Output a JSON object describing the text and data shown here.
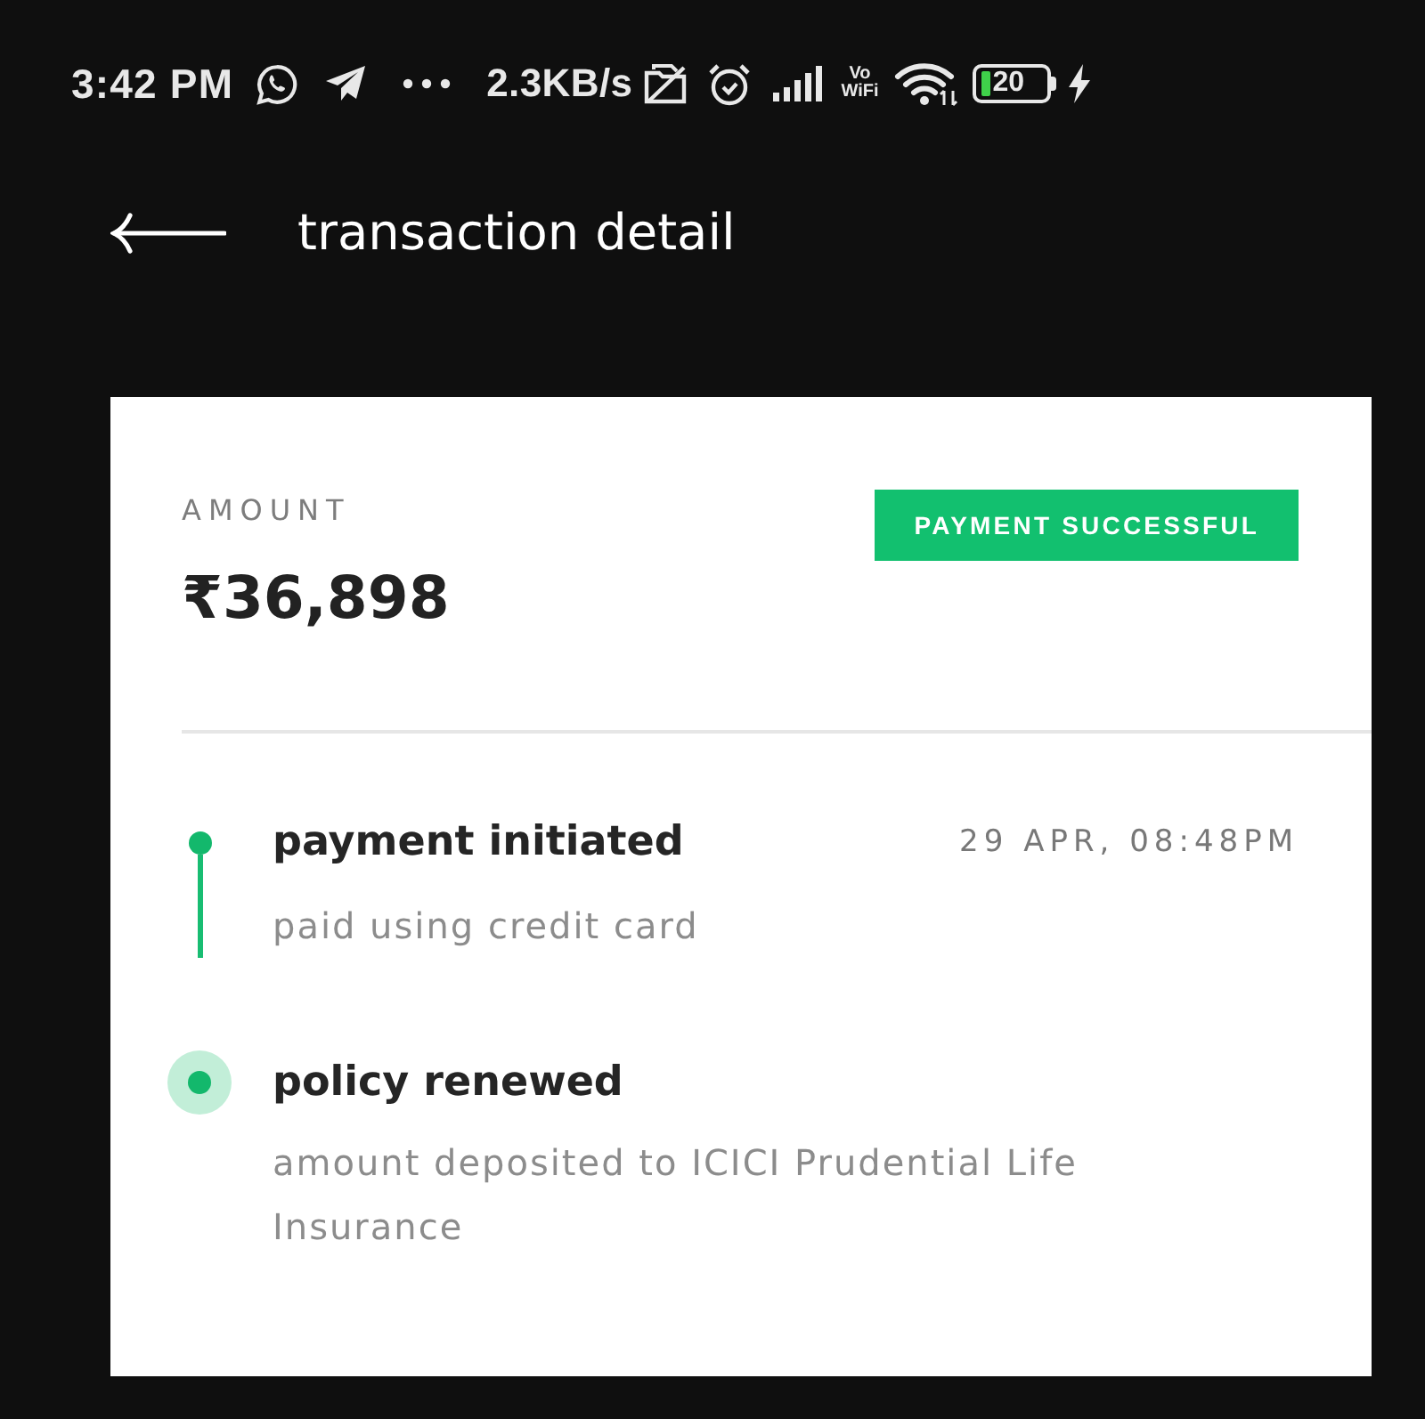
{
  "status_bar": {
    "time": "3:42 PM",
    "net_speed": "2.3KB/s",
    "vowifi_label": "Vo\nWiFi",
    "battery_text": "20"
  },
  "header": {
    "title": "transaction detail"
  },
  "summary": {
    "label": "AMOUNT",
    "amount": "₹36,898",
    "status_badge": "PAYMENT SUCCESSFUL"
  },
  "timeline": [
    {
      "title": "payment initiated",
      "time": "29 APR, 08:48PM",
      "subtitle": "paid using credit card",
      "current": false
    },
    {
      "title": "policy renewed",
      "subtitle": "amount deposited to ICICI Prudential Life Insurance",
      "current": true
    }
  ]
}
